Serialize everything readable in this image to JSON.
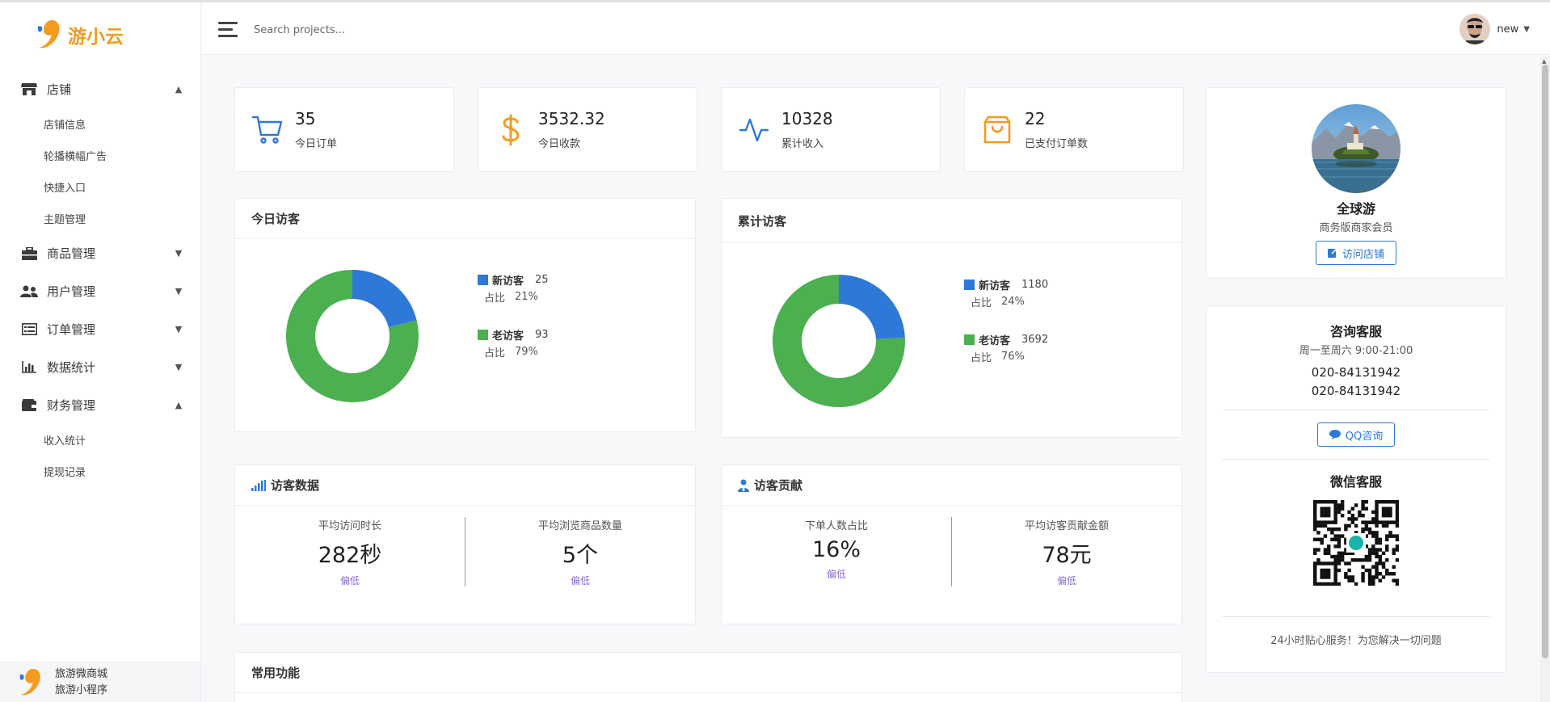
{
  "brand": {
    "name": "游小云"
  },
  "sidebar": {
    "groups": [
      {
        "label": "店铺",
        "icon": "store-icon",
        "expanded": true,
        "children": [
          "店铺信息",
          "轮播横幅广告",
          "快捷入口",
          "主题管理"
        ]
      },
      {
        "label": "商品管理",
        "icon": "briefcase-icon",
        "expanded": false,
        "children": []
      },
      {
        "label": "用户管理",
        "icon": "users-icon",
        "expanded": false,
        "children": []
      },
      {
        "label": "订单管理",
        "icon": "list-icon",
        "expanded": false,
        "children": []
      },
      {
        "label": "数据统计",
        "icon": "bar-chart-icon",
        "expanded": false,
        "children": []
      },
      {
        "label": "财务管理",
        "icon": "wallet-icon",
        "expanded": true,
        "children": [
          "收入统计",
          "提现记录"
        ]
      }
    ],
    "footer": {
      "line1": "旅游微商城",
      "line2": "旅游小程序"
    }
  },
  "header": {
    "search_placeholder": "Search projects...",
    "user_name": "new"
  },
  "stats": [
    {
      "value": "35",
      "label": "今日订单",
      "icon": "cart-icon",
      "color": "#2e78d8"
    },
    {
      "value": "3532.32",
      "label": "今日收款",
      "icon": "dollar-icon",
      "color": "#f29b1f"
    },
    {
      "value": "10328",
      "label": "累计收入",
      "icon": "activity-icon",
      "color": "#2e78d8"
    },
    {
      "value": "22",
      "label": "已支付订单数",
      "icon": "shopping-bag-icon",
      "color": "#f29b1f"
    }
  ],
  "today_visitors": {
    "title": "今日访客",
    "legend": [
      {
        "name": "新访客",
        "count": "25",
        "ratio_label": "占比",
        "ratio": "21%",
        "color": "#2e78d8"
      },
      {
        "name": "老访客",
        "count": "93",
        "ratio_label": "占比",
        "ratio": "79%",
        "color": "#4caf50"
      }
    ]
  },
  "total_visitors": {
    "title": "累计访客",
    "legend": [
      {
        "name": "新访客",
        "count": "1180",
        "ratio_label": "占比",
        "ratio": "24%",
        "color": "#2e78d8"
      },
      {
        "name": "老访客",
        "count": "3692",
        "ratio_label": "占比",
        "ratio": "76%",
        "color": "#4caf50"
      }
    ]
  },
  "chart_data": [
    {
      "type": "pie",
      "categories": [
        "新访客",
        "老访客"
      ],
      "values": [
        25,
        93
      ]
    },
    {
      "type": "pie",
      "categories": [
        "新访客",
        "老访客"
      ],
      "values": [
        1180,
        3692
      ]
    }
  ],
  "visitor_data": {
    "title": "访客数据",
    "metrics": [
      {
        "label": "平均访问时长",
        "value": "282秒",
        "note": "偏低"
      },
      {
        "label": "平均浏览商品数量",
        "value": "5个",
        "note": "偏低"
      }
    ]
  },
  "visitor_contribution": {
    "title": "访客贡献",
    "metrics": [
      {
        "label": "下单人数占比",
        "value": "16%",
        "note": "偏低"
      },
      {
        "label": "平均访客贡献金额",
        "value": "78元",
        "note": "偏低"
      }
    ]
  },
  "common_functions": {
    "title": "常用功能"
  },
  "profile": {
    "name": "全球游",
    "role": "商务版商家会员",
    "button": "访问店铺"
  },
  "support": {
    "title": "咨询客服",
    "hours": "周一至周六 9:00-21:00",
    "phones": [
      "020-84131942",
      "020-84131942"
    ],
    "qq_button": "QQ咨询",
    "wechat_title": "微信客服",
    "footer_note": "24小时贴心服务！为您解决一切问题"
  }
}
